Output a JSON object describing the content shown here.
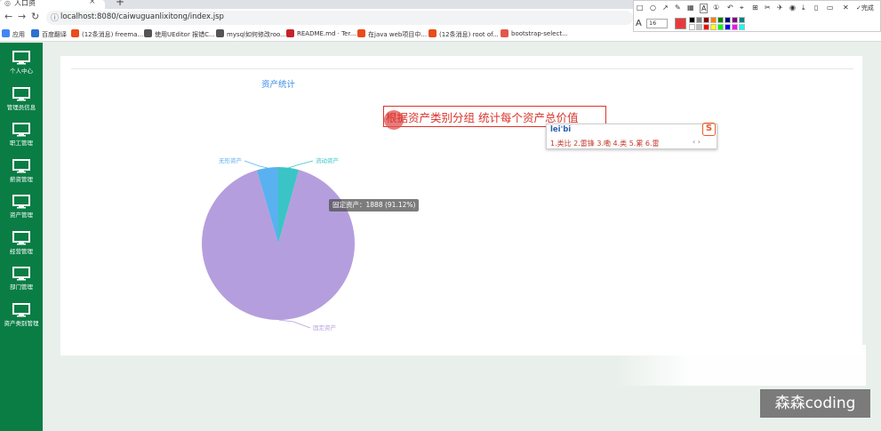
{
  "browser": {
    "tab_title": "人口资",
    "tab_close": "×",
    "new_tab": "+",
    "url": "localhost:8080/caiwuguanlixitong/index.jsp",
    "bookmarks": [
      {
        "label": "应用",
        "color": "#4285f4"
      },
      {
        "label": "百度翻译",
        "color": "#2d6fd2"
      },
      {
        "label": "(12条消息) freema...",
        "color": "#e84c1c"
      },
      {
        "label": "使用UEditor 报错C...",
        "color": "#555555"
      },
      {
        "label": "mysql如何修改roo...",
        "color": "#555555"
      },
      {
        "label": "README.md · Ter...",
        "color": "#c7222a"
      },
      {
        "label": "在java web项目中...",
        "color": "#e84c1c"
      },
      {
        "label": "(12条消息) root of...",
        "color": "#e84c1c"
      },
      {
        "label": "bootstrap-select...",
        "color": "#e2574c"
      }
    ]
  },
  "annotation_toolbar": {
    "finish_label": "完成",
    "font_size": "16",
    "current_color": "#e83a3a",
    "swatches": [
      "#000000",
      "#808080",
      "#800000",
      "#ff8000",
      "#008000",
      "#000080",
      "#800080",
      "#008080",
      "#ffffff",
      "#c0c0c0",
      "#ff0000",
      "#ffff00",
      "#00ff00",
      "#0000ff",
      "#ff00ff",
      "#00ffff"
    ]
  },
  "sidebar": {
    "items": [
      {
        "label": "个人中心"
      },
      {
        "label": "管理员信息"
      },
      {
        "label": "职工管理"
      },
      {
        "label": "薪资管理"
      },
      {
        "label": "资产管理"
      },
      {
        "label": "经营管理"
      },
      {
        "label": "部门管理"
      },
      {
        "label": "资产类别管理"
      }
    ]
  },
  "main": {
    "section_title": "资产统计",
    "chart_heading": "根据资产类别分组 统计每个资产总价值"
  },
  "ime": {
    "input": "lei'bi",
    "candidates": "1.类比  2.雷锋  3.嘞  4.类  5.累  6.雷",
    "nav": "‹ ›"
  },
  "watermark": "森森coding",
  "chart_data": {
    "type": "pie",
    "series": [
      {
        "name": "流动资产",
        "value": 90,
        "color": "#3bc4c6"
      },
      {
        "name": "固定资产",
        "value": 1888,
        "color": "#b59edd"
      },
      {
        "name": "无形资产",
        "value": 94,
        "color": "#5ab1ef"
      }
    ],
    "tooltip": "固定资产：1888 (91.12%)"
  }
}
